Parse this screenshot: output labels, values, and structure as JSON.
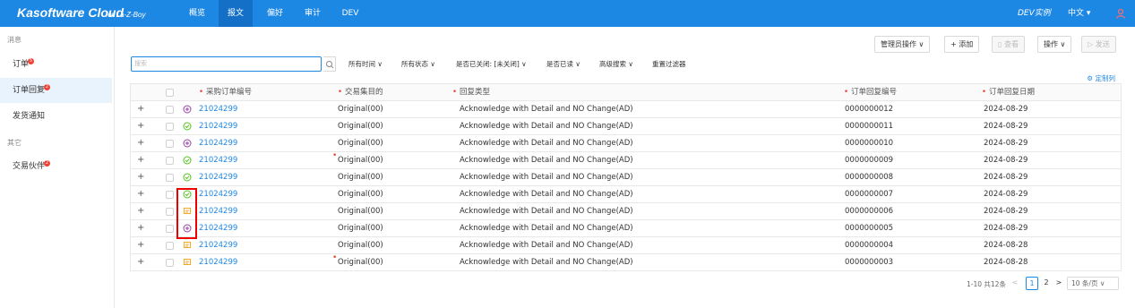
{
  "header": {
    "brand": "Kasoftware Cloud",
    "brand_sub": "for La-Z-Boy",
    "tabs": [
      {
        "label": "概览",
        "active": false
      },
      {
        "label": "报文",
        "active": true
      },
      {
        "label": "偏好",
        "active": false
      },
      {
        "label": "审计",
        "active": false
      },
      {
        "label": "DEV",
        "active": false
      }
    ],
    "instance": "DEV实例",
    "language": "中文 ▾",
    "user_icon": "user-icon"
  },
  "sidebar": {
    "group1": "消息",
    "items": [
      {
        "label": "订单",
        "badge": "5"
      },
      {
        "label": "订单回复",
        "badge": "2",
        "active": true
      },
      {
        "label": "发货通知",
        "badge": ""
      }
    ],
    "group2": "其它",
    "items2": [
      {
        "label": "交易伙伴",
        "badge": "2"
      }
    ]
  },
  "toolbar": {
    "admin_ops": "管理员操作 ∨",
    "add": "+ 添加",
    "view": "查看",
    "ops": "操作 ∨",
    "send": "发送"
  },
  "search": {
    "placeholder": "搜索"
  },
  "filters": {
    "time": "所有时间 ∨",
    "status": "所有状态 ∨",
    "closed": "是否已关闭: [未关闭] ∨",
    "read": "是否已读 ∨",
    "advanced": "高级搜索 ∨",
    "reset": "重置过滤器"
  },
  "customize": "定制列",
  "table": {
    "columns": [
      "采购订单编号",
      "交易集目的",
      "回复类型",
      "订单回复编号",
      "订单回复日期"
    ],
    "rows": [
      {
        "status": "plus-circle",
        "po": "21024299",
        "purpose": "Original(00)",
        "type": "Acknowledge with Detail and NO Change(AD)",
        "ack_no": "0000000012",
        "date": "2024-08-29",
        "dot": false
      },
      {
        "status": "check-circle",
        "po": "21024299",
        "purpose": "Original(00)",
        "type": "Acknowledge with Detail and NO Change(AD)",
        "ack_no": "0000000011",
        "date": "2024-08-29",
        "dot": false
      },
      {
        "status": "plus-circle",
        "po": "21024299",
        "purpose": "Original(00)",
        "type": "Acknowledge with Detail and NO Change(AD)",
        "ack_no": "0000000010",
        "date": "2024-08-29",
        "dot": false
      },
      {
        "status": "check-circle",
        "po": "21024299",
        "purpose": "Original(00)",
        "type": "Acknowledge with Detail and NO Change(AD)",
        "ack_no": "0000000009",
        "date": "2024-08-29",
        "dot": true
      },
      {
        "status": "check-circle",
        "po": "21024299",
        "purpose": "Original(00)",
        "type": "Acknowledge with Detail and NO Change(AD)",
        "ack_no": "0000000008",
        "date": "2024-08-29",
        "dot": false
      },
      {
        "status": "check-circle",
        "po": "21024299",
        "purpose": "Original(00)",
        "type": "Acknowledge with Detail and NO Change(AD)",
        "ack_no": "0000000007",
        "date": "2024-08-29",
        "dot": false
      },
      {
        "status": "message",
        "po": "21024299",
        "purpose": "Original(00)",
        "type": "Acknowledge with Detail and NO Change(AD)",
        "ack_no": "0000000006",
        "date": "2024-08-29",
        "dot": false
      },
      {
        "status": "plus-circle",
        "po": "21024299",
        "purpose": "Original(00)",
        "type": "Acknowledge with Detail and NO Change(AD)",
        "ack_no": "0000000005",
        "date": "2024-08-29",
        "dot": false
      },
      {
        "status": "message",
        "po": "21024299",
        "purpose": "Original(00)",
        "type": "Acknowledge with Detail and NO Change(AD)",
        "ack_no": "0000000004",
        "date": "2024-08-28",
        "dot": false
      },
      {
        "status": "message",
        "po": "21024299",
        "purpose": "Original(00)",
        "type": "Acknowledge with Detail and NO Change(AD)",
        "ack_no": "0000000003",
        "date": "2024-08-28",
        "dot": true
      }
    ]
  },
  "pagination": {
    "summary": "1-10 共12条",
    "pages": [
      "1",
      "2"
    ],
    "current": "1",
    "prev": "<",
    "next": ">",
    "page_size": "10 条/页 ∨"
  },
  "colors": {
    "primary": "#1d87e4",
    "check": "#52c41a",
    "plus": "#9b3fa8",
    "message": "#f5a623",
    "highlight": "#e00000"
  }
}
